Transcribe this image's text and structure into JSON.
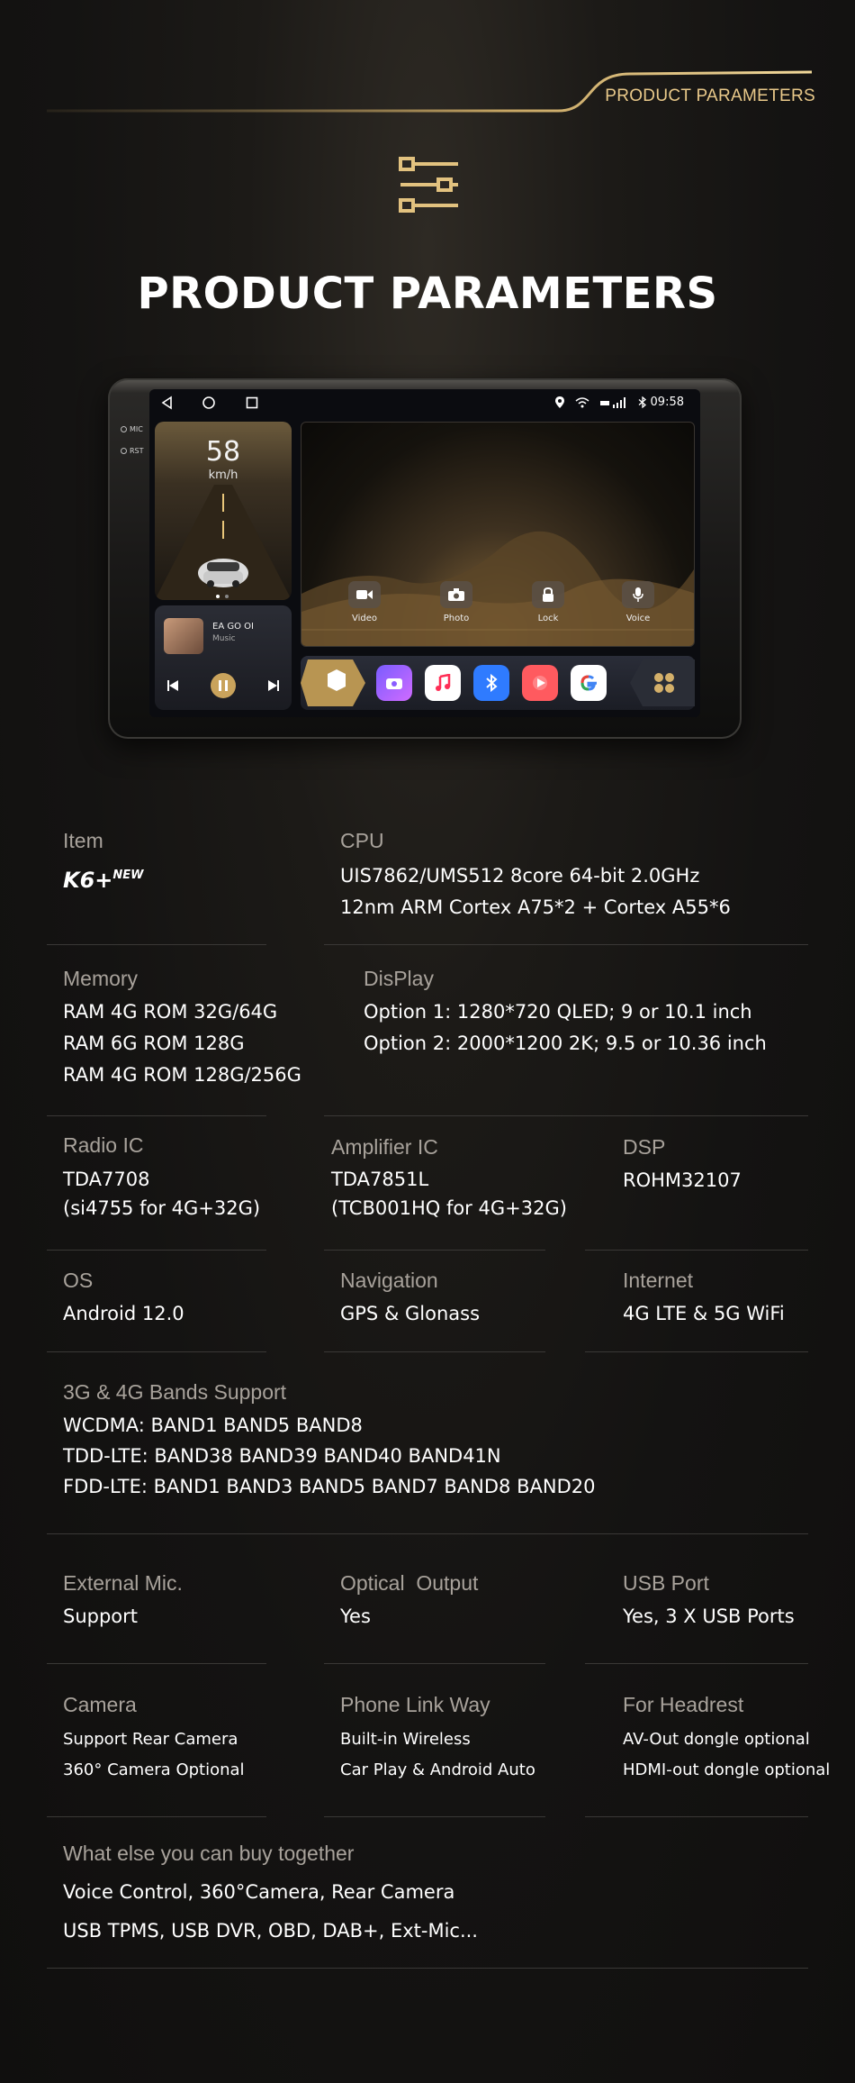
{
  "banner": {
    "label": "PRODUCT PARAMETERS"
  },
  "page_title": "PRODUCT PARAMETERS",
  "device": {
    "side_labels": [
      "MIC",
      "RST"
    ],
    "status": {
      "time": "09:58"
    },
    "speed": {
      "value": "58",
      "unit": "km/h"
    },
    "quick_buttons": [
      "Video",
      "Photo",
      "Lock",
      "Voice"
    ],
    "music": {
      "title": "EA GO OI",
      "subtitle": "Music"
    }
  },
  "specs": {
    "item": {
      "label": "Item",
      "logo": "K6+",
      "logo_sup": "NEW"
    },
    "cpu": {
      "label": "CPU",
      "lines": [
        "UIS7862/UMS512 8core 64-bit 2.0GHz",
        "12nm ARM Cortex A75*2 + Cortex A55*6"
      ]
    },
    "memory": {
      "label": "Memory",
      "lines": [
        "RAM 4G ROM 32G/64G",
        "RAM 6G ROM 128G",
        "RAM 4G ROM 128G/256G"
      ]
    },
    "display": {
      "label": "DisPlay",
      "lines": [
        "Option 1: 1280*720 QLED; 9 or 10.1 inch",
        "Option 2: 2000*1200 2K; 9.5 or 10.36 inch"
      ]
    },
    "radio_ic": {
      "label": "Radio IC",
      "lines": [
        "TDA7708",
        "(si4755 for 4G+32G)"
      ]
    },
    "amplifier_ic": {
      "label": "Amplifier IC",
      "lines": [
        "TDA7851L",
        "(TCB001HQ for 4G+32G)"
      ]
    },
    "dsp": {
      "label": "DSP",
      "lines": [
        "ROHM32107"
      ]
    },
    "os": {
      "label": "OS",
      "lines": [
        "Android 12.0"
      ]
    },
    "navigation": {
      "label": "Navigation",
      "lines": [
        "GPS & Glonass"
      ]
    },
    "internet": {
      "label": "Internet",
      "lines": [
        "4G LTE & 5G WiFi"
      ]
    },
    "bands": {
      "label": "3G & 4G Bands Support",
      "lines": [
        "WCDMA: BAND1 BAND5 BAND8",
        "TDD-LTE: BAND38 BAND39 BAND40 BAND41N",
        "FDD-LTE: BAND1 BAND3 BAND5 BAND7 BAND8 BAND20"
      ]
    },
    "external_mic": {
      "label": "External Mic.",
      "lines": [
        "Support"
      ]
    },
    "optical_output": {
      "label": "Optical  Output",
      "lines": [
        "Yes"
      ]
    },
    "usb_port": {
      "label": "USB Port",
      "lines": [
        "Yes, 3 X USB Ports"
      ]
    },
    "camera": {
      "label": "Camera",
      "lines": [
        "Support Rear Camera",
        "360° Camera Optional"
      ]
    },
    "phone_link": {
      "label": "Phone Link Way",
      "lines": [
        "Built-in Wireless",
        "Car Play & Android Auto"
      ]
    },
    "headrest": {
      "label": "For Headrest",
      "lines": [
        "AV-Out dongle optional",
        "HDMI-out dongle optional"
      ]
    },
    "extras": {
      "label": "What else you can buy together",
      "lines": [
        "Voice Control, 360°Camera, Rear Camera",
        "USB TPMS, USB DVR, OBD, DAB+, Ext-Mic..."
      ]
    }
  }
}
